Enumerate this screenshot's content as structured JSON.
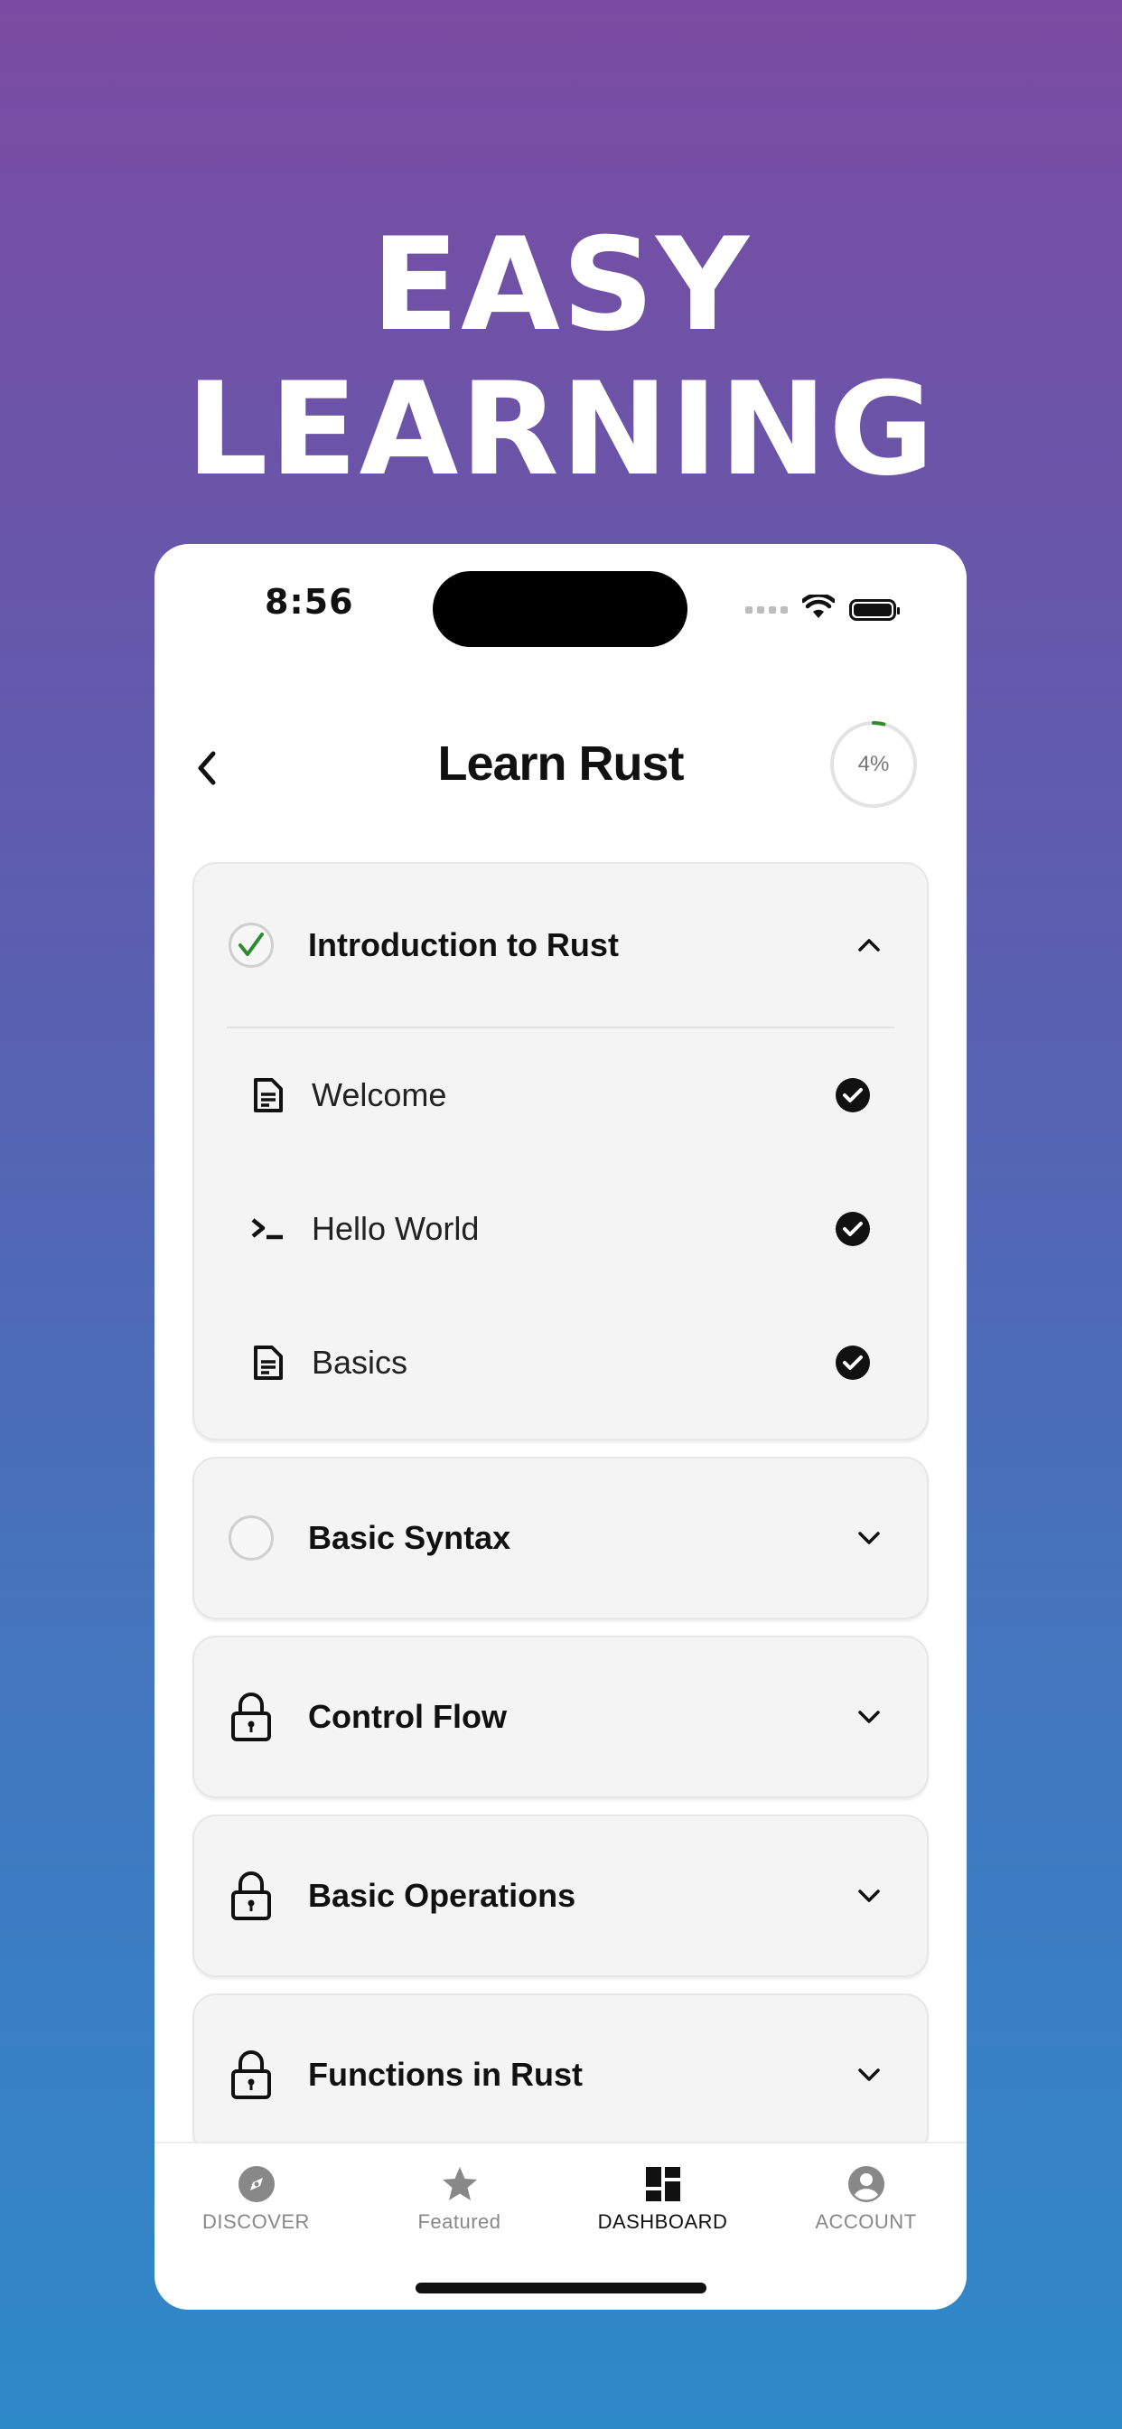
{
  "promo": {
    "headline": "EASY LEARNING"
  },
  "status_bar": {
    "time": "8:56"
  },
  "header": {
    "title": "Learn Rust",
    "progress_label": "4%",
    "progress_value": 0.04,
    "progress_color": "#2e8b2e"
  },
  "modules": [
    {
      "title": "Introduction to Rust",
      "state": "completed",
      "expanded": true,
      "lessons": [
        {
          "label": "Welcome",
          "icon": "document-icon",
          "done": true
        },
        {
          "label": "Hello World",
          "icon": "terminal-icon",
          "done": true
        },
        {
          "label": "Basics",
          "icon": "document-icon",
          "done": true
        }
      ]
    },
    {
      "title": "Basic Syntax",
      "state": "unlocked",
      "expanded": false
    },
    {
      "title": "Control Flow",
      "state": "locked",
      "expanded": false
    },
    {
      "title": "Basic Operations",
      "state": "locked",
      "expanded": false
    },
    {
      "title": "Functions in Rust",
      "state": "locked",
      "expanded": false
    }
  ],
  "tabbar": {
    "tabs": [
      {
        "label": "DISCOVER",
        "icon": "compass-icon",
        "active": false
      },
      {
        "label": "Featured",
        "icon": "star-icon",
        "active": false
      },
      {
        "label": "DASHBOARD",
        "icon": "dashboard-icon",
        "active": true
      },
      {
        "label": "ACCOUNT",
        "icon": "account-icon",
        "active": false
      }
    ]
  },
  "colors": {
    "check_green": "#2e8b2e",
    "text_dark": "#111111",
    "inactive_tab": "#888888"
  }
}
